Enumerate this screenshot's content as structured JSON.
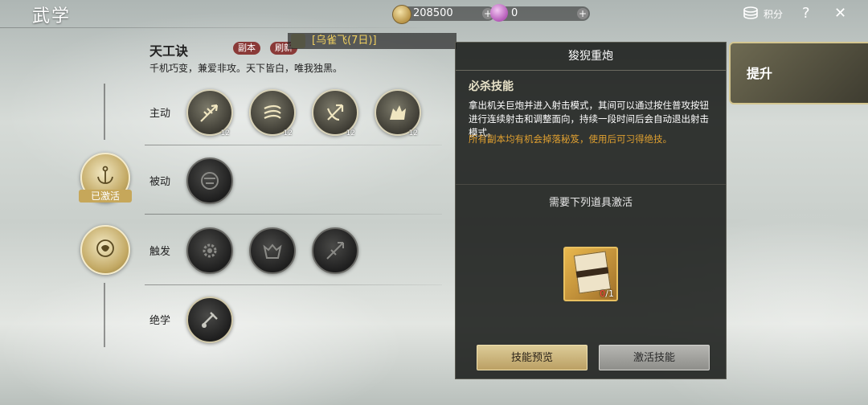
{
  "header": {
    "title": "武学",
    "gold_amount": "208500",
    "gem_amount": "0",
    "points_label": "积分",
    "help_label": "?",
    "close_label": "✕"
  },
  "manual": {
    "name": "天工诀",
    "tag_dungeon": "副本",
    "tag_refresh": "刷新",
    "duration_text": "[乌雀飞(7日)]",
    "motto": "千机巧变，兼爱非攻。天下皆白，唯我独黑。"
  },
  "rows": {
    "active_label": "主动",
    "passive_label": "被动",
    "trigger_label": "触发",
    "ultimate_label": "绝学"
  },
  "active_skills": [
    {
      "icon": "arrow-burst-icon",
      "level": "12"
    },
    {
      "icon": "whirl-icon",
      "level": "12"
    },
    {
      "icon": "crossbow-icon",
      "level": "12"
    },
    {
      "icon": "wolf-head-icon",
      "level": "12"
    }
  ],
  "passive_orb_badge": "已激活",
  "panel": {
    "title": "狻猊重炮",
    "skill_type": "必杀技能",
    "description": "拿出机关巨炮并进入射击模式，其间可以通过按住普攻按钮进行连续射击和调整面向，持续一段时间后会自动退出射击模式。",
    "drop_note": "所有副本均有机会掉落秘笈，使用后可习得绝技。",
    "requirement": "需要下列道具激活",
    "item_have": "0",
    "item_need": "/1",
    "preview_button": "技能预览",
    "activate_button": "激活技能"
  },
  "upgrade_tab": "提升",
  "colors": {
    "gold_accent": "#d4c690",
    "warning_orange": "#e0a030",
    "panel_bg": "#181a18"
  }
}
